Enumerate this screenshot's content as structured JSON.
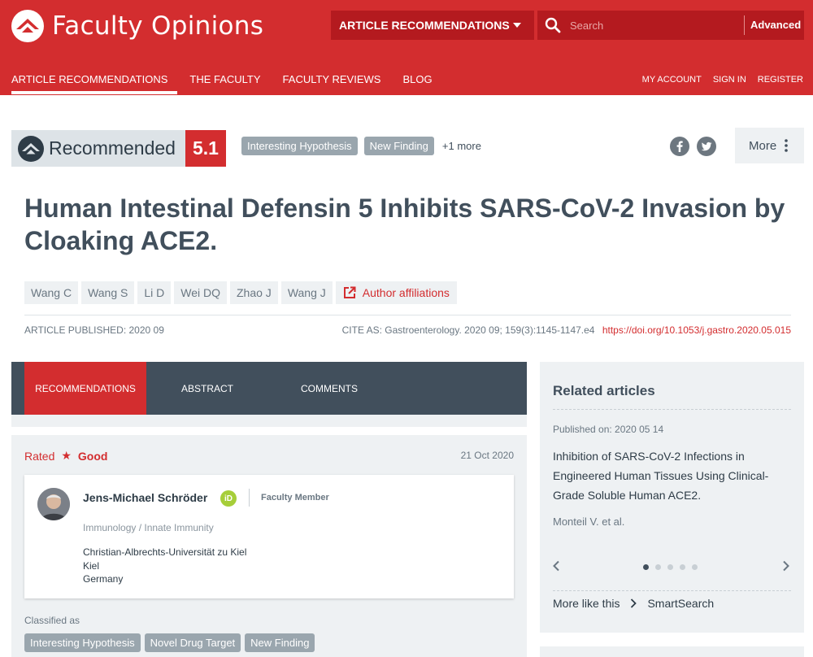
{
  "header": {
    "brand": "Faculty Opinions",
    "section_select": "ARTICLE RECOMMENDATIONS",
    "search_placeholder": "Search",
    "advanced_label": "Advanced",
    "nav": [
      "ARTICLE RECOMMENDATIONS",
      "THE FACULTY",
      "FACULTY REVIEWS",
      "BLOG"
    ],
    "account": [
      "MY ACCOUNT",
      "SIGN IN",
      "REGISTER"
    ],
    "accent_color": "#d32d2f"
  },
  "badge": {
    "label": "Recommended",
    "score": "5.1",
    "tags": [
      "Interesting Hypothesis",
      "New Finding"
    ],
    "more_tags": "+1 more",
    "more_button": "More"
  },
  "article": {
    "title": "Human Intestinal Defensin 5 Inhibits SARS-CoV-2 Invasion by Cloaking ACE2.",
    "authors": [
      "Wang C",
      "Wang S",
      "Li D",
      "Wei DQ",
      "Zhao J",
      "Wang J"
    ],
    "affiliations_label": "Author affiliations",
    "published": "ARTICLE PUBLISHED: 2020 09",
    "cite_as": "CITE AS: Gastroenterology. 2020 09; 159(3):1145-1147.e4",
    "doi": "https://doi.org/10.1053/j.gastro.2020.05.015"
  },
  "tabs": [
    "RECOMMENDATIONS",
    "ABSTRACT",
    "COMMENTS"
  ],
  "recommendation": {
    "rated_label": "Rated",
    "rating": "Good",
    "date": "21 Oct 2020",
    "reviewer": {
      "name": "Jens-Michael Schröder",
      "orcid": "iD",
      "role": "Faculty Member",
      "field": "Immunology / Innate Immunity",
      "institution": "Christian-Albrechts-Universität zu Kiel",
      "city": "Kiel",
      "country": "Germany"
    },
    "classified_label": "Classified as",
    "classified_tags": [
      "Interesting Hypothesis",
      "Novel Drug Target",
      "New Finding"
    ]
  },
  "related": {
    "heading": "Related articles",
    "published_on": "Published on: 2020 05 14",
    "title": "Inhibition of SARS-CoV-2 Infections in Engineered Human Tissues Using Clinical-Grade Soluble Human ACE2.",
    "authors": "Monteil V. et al.",
    "carousel_index": 1,
    "carousel_count": 5,
    "more_like_this": "More like this",
    "smartsearch": "SmartSearch"
  }
}
